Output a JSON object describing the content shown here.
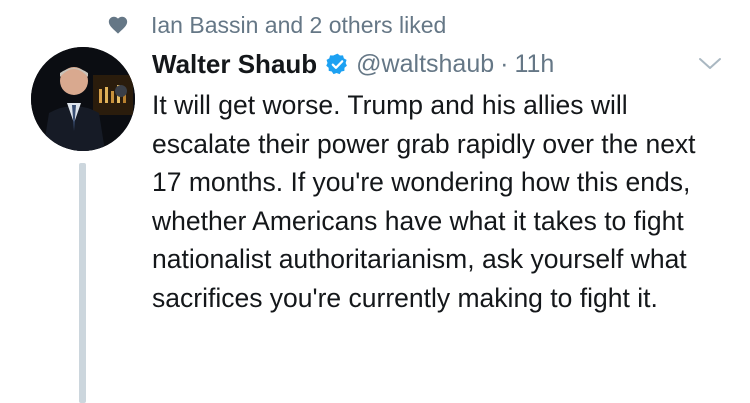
{
  "social_context": {
    "icon": "heart-icon",
    "text": "Ian Bassin and 2 others liked"
  },
  "tweet": {
    "display_name": "Walter Shaub",
    "verified": true,
    "handle": "@waltshaub",
    "separator": "·",
    "time": "11h",
    "text": "It will get worse. Trump and his allies will escalate their power grab rapidly over the next 17 months. If you're wondering how this ends, whether Americans have what it takes to fight nationalist authoritarianism, ask yourself what sacrifices you're currently making to fight it."
  },
  "colors": {
    "muted": "#657786",
    "text": "#14171a",
    "verified": "#1da1f2",
    "thread_line": "#ccd6dd"
  }
}
